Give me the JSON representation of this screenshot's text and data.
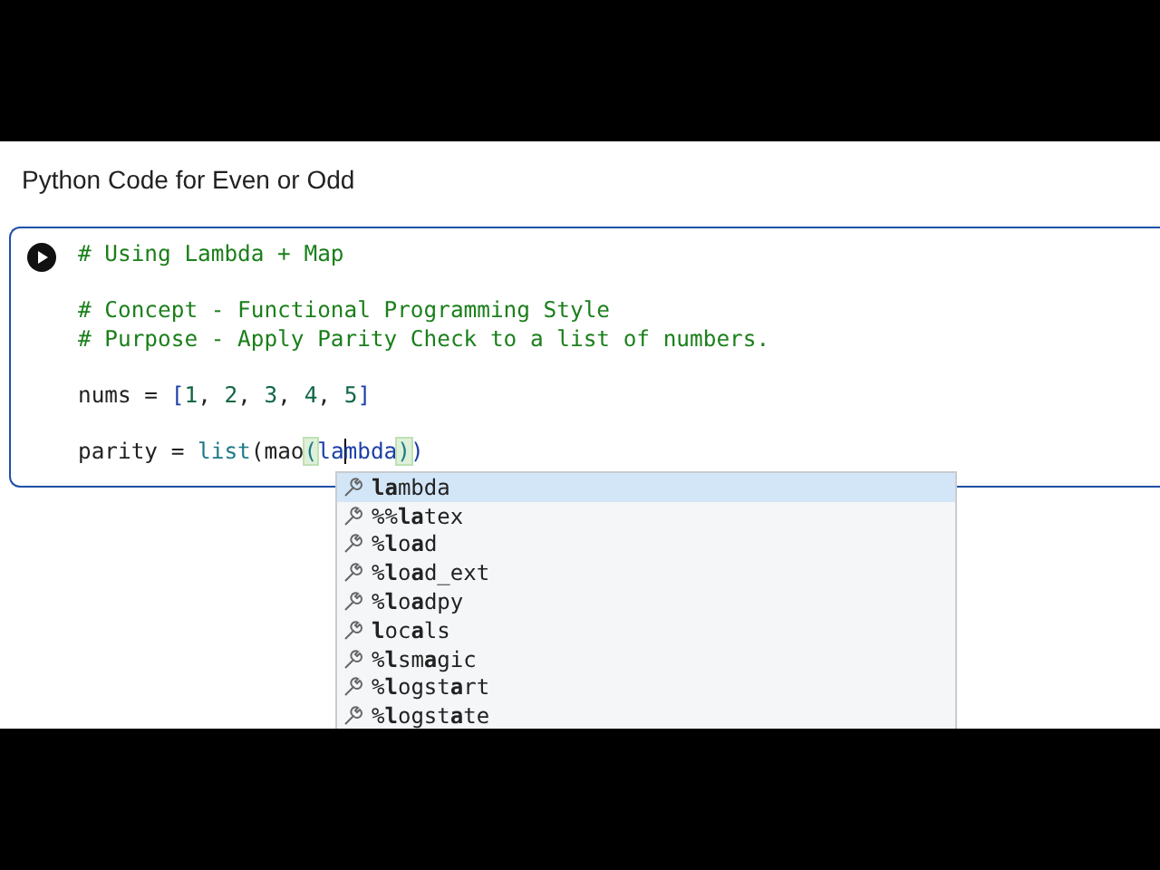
{
  "notebook": {
    "heading": "Python Code for Even or Odd"
  },
  "cell": {
    "focused": true,
    "lines": [
      {
        "kind": "code",
        "segments": [
          {
            "kind": "comment",
            "text": "# Using Lambda + Map"
          }
        ]
      },
      {
        "kind": "blank"
      },
      {
        "kind": "code",
        "segments": [
          {
            "kind": "comment",
            "text": "# Concept - Functional Programming Style"
          }
        ]
      },
      {
        "kind": "code",
        "segments": [
          {
            "kind": "comment",
            "text": "# Purpose - Apply Parity Check to a list of numbers."
          }
        ]
      },
      {
        "kind": "blank"
      },
      {
        "kind": "code",
        "segments": [
          {
            "kind": "plain",
            "text": "nums = "
          },
          {
            "kind": "bracket",
            "text": "["
          },
          {
            "kind": "number",
            "text": "1"
          },
          {
            "kind": "plain",
            "text": ", "
          },
          {
            "kind": "number",
            "text": "2"
          },
          {
            "kind": "plain",
            "text": ", "
          },
          {
            "kind": "number",
            "text": "3"
          },
          {
            "kind": "plain",
            "text": ", "
          },
          {
            "kind": "number",
            "text": "4"
          },
          {
            "kind": "plain",
            "text": ", "
          },
          {
            "kind": "number",
            "text": "5"
          },
          {
            "kind": "bracket",
            "text": "]"
          }
        ]
      },
      {
        "kind": "blank"
      },
      {
        "kind": "code",
        "segments": [
          {
            "kind": "plain",
            "text": "parity = "
          },
          {
            "kind": "builtin",
            "text": "list"
          },
          {
            "kind": "plain",
            "text": "(mao"
          },
          {
            "kind": "match",
            "text": "("
          },
          {
            "kind": "keyword",
            "text": "la",
            "cursor": true
          },
          {
            "kind": "keyword",
            "text": "mbda"
          },
          {
            "kind": "match",
            "text": ")"
          },
          {
            "kind": "bracket",
            "text": ")"
          }
        ]
      }
    ]
  },
  "completions": [
    {
      "label": "**la**mbda",
      "selected": true
    },
    {
      "label": "%%**la**tex",
      "selected": false
    },
    {
      "label": "%**l**o**a**d",
      "selected": false
    },
    {
      "label": "%**l**o**a**d_ext",
      "selected": false
    },
    {
      "label": "%**l**o**a**dpy",
      "selected": false
    },
    {
      "label": "**l**oc**a**ls",
      "selected": false
    },
    {
      "label": "%**l**sm**a**gic",
      "selected": false
    },
    {
      "label": "%**l**ogst**a**rt",
      "selected": false
    },
    {
      "label": "%**l**ogst**a**te",
      "selected": false
    }
  ]
}
